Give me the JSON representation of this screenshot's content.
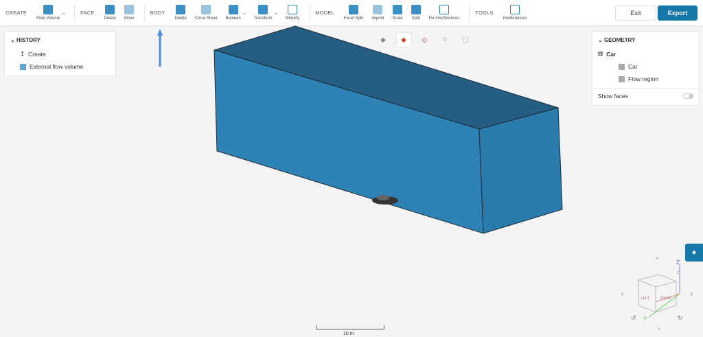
{
  "toolbar": {
    "create": {
      "label": "CREATE",
      "tools": [
        {
          "label": "Flow Volume"
        }
      ]
    },
    "face": {
      "label": "FACE",
      "tools": [
        {
          "label": "Delete"
        },
        {
          "label": "Move"
        }
      ]
    },
    "body": {
      "label": "BODY",
      "tools": [
        {
          "label": "Delete"
        },
        {
          "label": "Close Sheet"
        },
        {
          "label": "Boolean"
        },
        {
          "label": "Transform"
        },
        {
          "label": "Simplify"
        }
      ]
    },
    "model": {
      "label": "MODEL",
      "tools": [
        {
          "label": "Facet Split"
        },
        {
          "label": "Imprint"
        },
        {
          "label": "Scale"
        },
        {
          "label": "Split"
        },
        {
          "label": "Fix Interferences"
        }
      ]
    },
    "tools": {
      "label": "TOOLS",
      "tools": [
        {
          "label": "Interferences"
        }
      ]
    },
    "exit_label": "Exit",
    "export_label": "Export"
  },
  "history": {
    "title": "HISTORY",
    "items": [
      {
        "label": "Create",
        "icon": "upload-icon"
      },
      {
        "label": "External flow volume",
        "icon": "cube-icon"
      }
    ]
  },
  "geometry": {
    "title": "GEOMETRY",
    "root": "Car",
    "children": [
      {
        "label": "Car"
      },
      {
        "label": "Flow region"
      }
    ],
    "show_faces_label": "Show faces",
    "show_faces": false
  },
  "viewport": {
    "box_colors": {
      "top": "#255e82",
      "front": "#2f82b5",
      "right": "#2b7bad"
    },
    "scale_label": "10 m",
    "axes": {
      "z": "Z",
      "y": "Y"
    },
    "cube_faces": {
      "left": "LEFT",
      "front": "FRONT"
    }
  },
  "colors": {
    "accent": "#1678a8",
    "highlight_arrow": "#4a8be0"
  }
}
